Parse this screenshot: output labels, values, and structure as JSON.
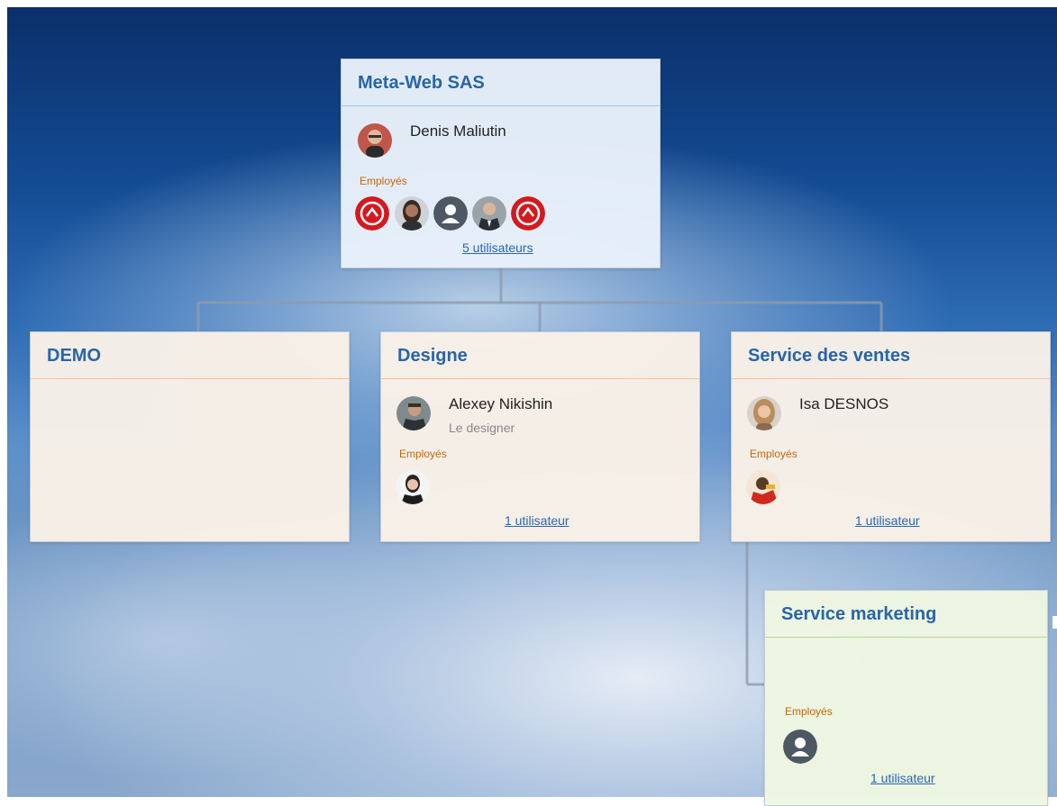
{
  "root": {
    "title": "Meta-Web SAS",
    "head_name": "Denis Maliutin",
    "employees_label": "Employés",
    "employees": [
      {
        "icon": "red-badge-icon"
      },
      {
        "icon": "woman-photo-avatar"
      },
      {
        "icon": "default-user-icon"
      },
      {
        "icon": "man-suit-photo-avatar"
      },
      {
        "icon": "red-badge-icon"
      }
    ],
    "users_link": "5 utilisateurs"
  },
  "departments": [
    {
      "title": "DEMO"
    },
    {
      "title": "Designe",
      "head_name": "Alexey Nikishin",
      "head_role": "Le designer",
      "employees_label": "Employés",
      "users_link": "1 utilisateur"
    },
    {
      "title": "Service des ventes",
      "head_name": "Isa DESNOS",
      "employees_label": "Employés",
      "users_link": "1 utilisateur"
    }
  ],
  "marketing": {
    "title": "Service marketing",
    "employees_label": "Employés",
    "users_link": "1 utilisateur"
  },
  "colors": {
    "title_blue": "#2865a8",
    "employees_orange": "#c5680c",
    "link_blue": "#2a66b0"
  }
}
